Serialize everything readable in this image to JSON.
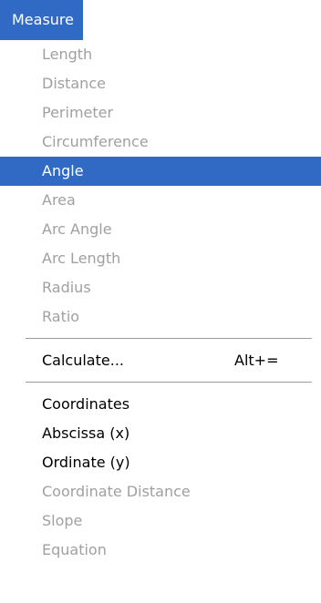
{
  "menu_title": "Measure",
  "menu_items": [
    {
      "label": "Length",
      "enabled": false
    },
    {
      "label": "Distance",
      "enabled": false
    },
    {
      "label": "Perimeter",
      "enabled": false
    },
    {
      "label": "Circumference",
      "enabled": false
    },
    {
      "label": "Angle",
      "enabled": true,
      "selected": true
    },
    {
      "label": "Area",
      "enabled": false
    },
    {
      "label": "Arc Angle",
      "enabled": false
    },
    {
      "label": "Arc Length",
      "enabled": false
    },
    {
      "label": "Radius",
      "enabled": false
    },
    {
      "label": "Ratio",
      "enabled": false
    },
    {
      "label": "Calculate...",
      "shortcut": "Alt+=",
      "enabled": true
    },
    {
      "label": "Coordinates",
      "enabled": true
    },
    {
      "label": "Abscissa (x)",
      "enabled": true
    },
    {
      "label": "Ordinate (y)",
      "enabled": true
    },
    {
      "label": "Coordinate Distance",
      "enabled": false
    },
    {
      "label": "Slope",
      "enabled": false
    },
    {
      "label": "Equation",
      "enabled": false
    }
  ],
  "colors": {
    "highlight": "#316ac5",
    "disabled_text": "#a0a0a0"
  }
}
